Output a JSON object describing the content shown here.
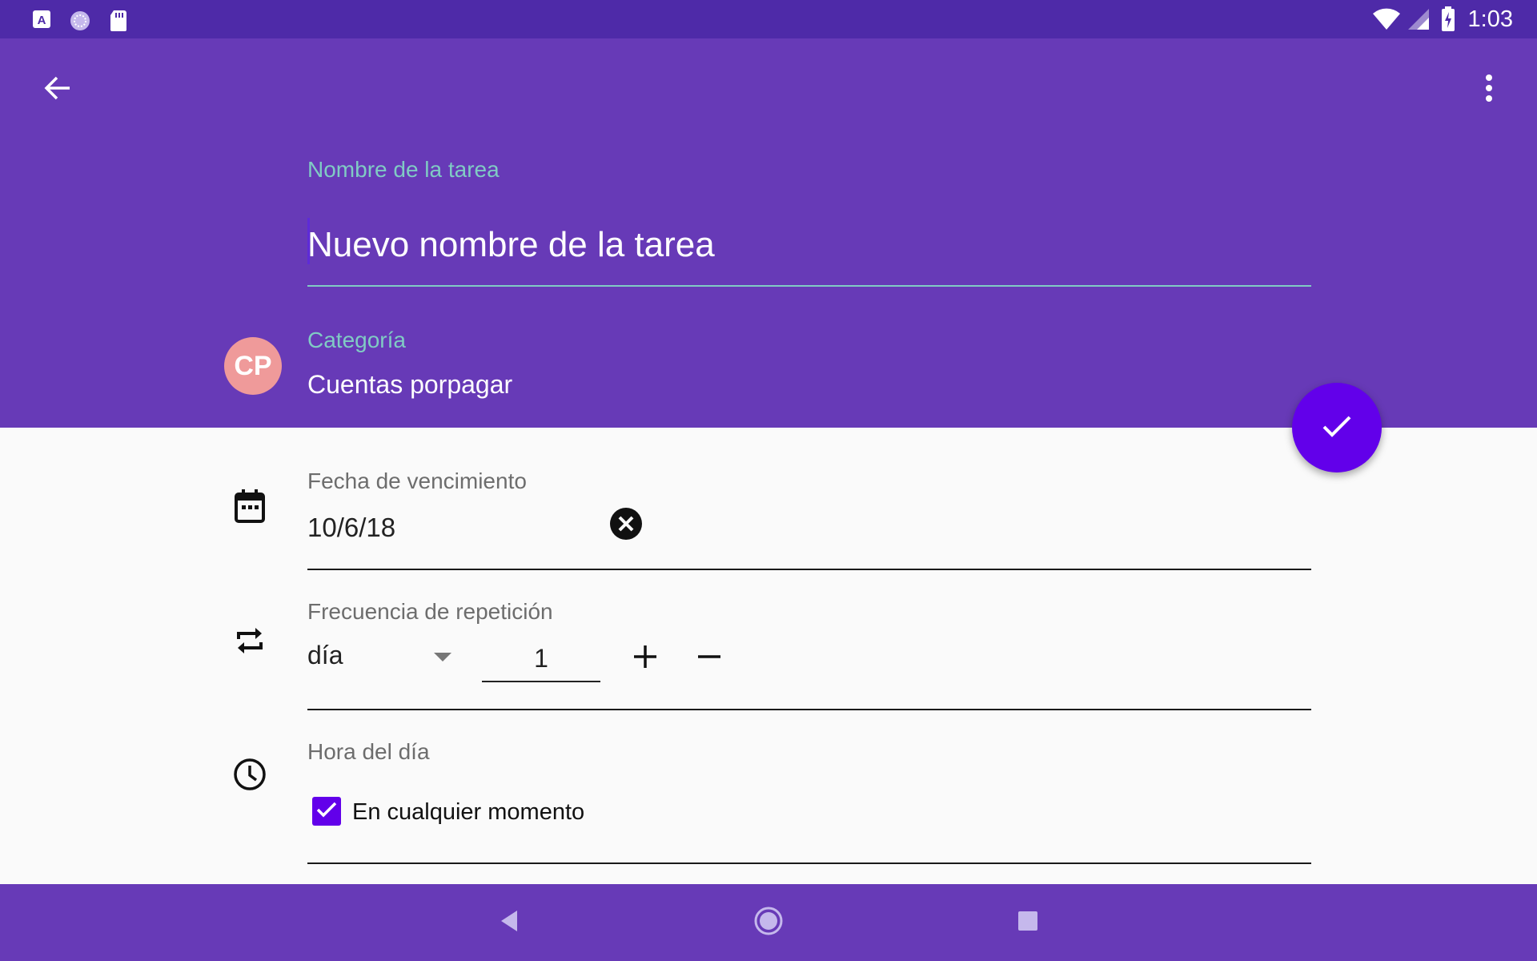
{
  "status_bar": {
    "time": "1:03",
    "left_icons": [
      "a-notification-icon",
      "sync-icon",
      "sd-card-icon"
    ],
    "right_icons": [
      "wifi-icon",
      "signal-icon",
      "battery-charging-icon"
    ]
  },
  "header": {
    "back_icon": "arrow-back-icon",
    "overflow_icon": "more-vert-icon",
    "task_name_label": "Nombre de la tarea",
    "task_name_value": "Nuevo nombre de la tarea",
    "category_label": "Categoría",
    "category_value": "Cuentas porpagar",
    "category_avatar": "CP"
  },
  "fab": {
    "icon": "check-icon"
  },
  "due_date": {
    "label": "Fecha de vencimiento",
    "value": "10/6/18",
    "clear_icon": "clear-circle-icon"
  },
  "repeat": {
    "label": "Frecuencia de repetición",
    "unit_selected": "día",
    "count": "1",
    "plus_icon": "plus-icon",
    "minus_icon": "minus-icon"
  },
  "time_of_day": {
    "label": "Hora del día",
    "anytime_label": "En cualquier momento",
    "anytime_checked": true
  },
  "colors": {
    "status_bar": "#4e2aa8",
    "primary": "#673ab7",
    "accent": "#6200ea",
    "label_teal": "#80cbc4",
    "avatar": "#ef9a9a"
  }
}
